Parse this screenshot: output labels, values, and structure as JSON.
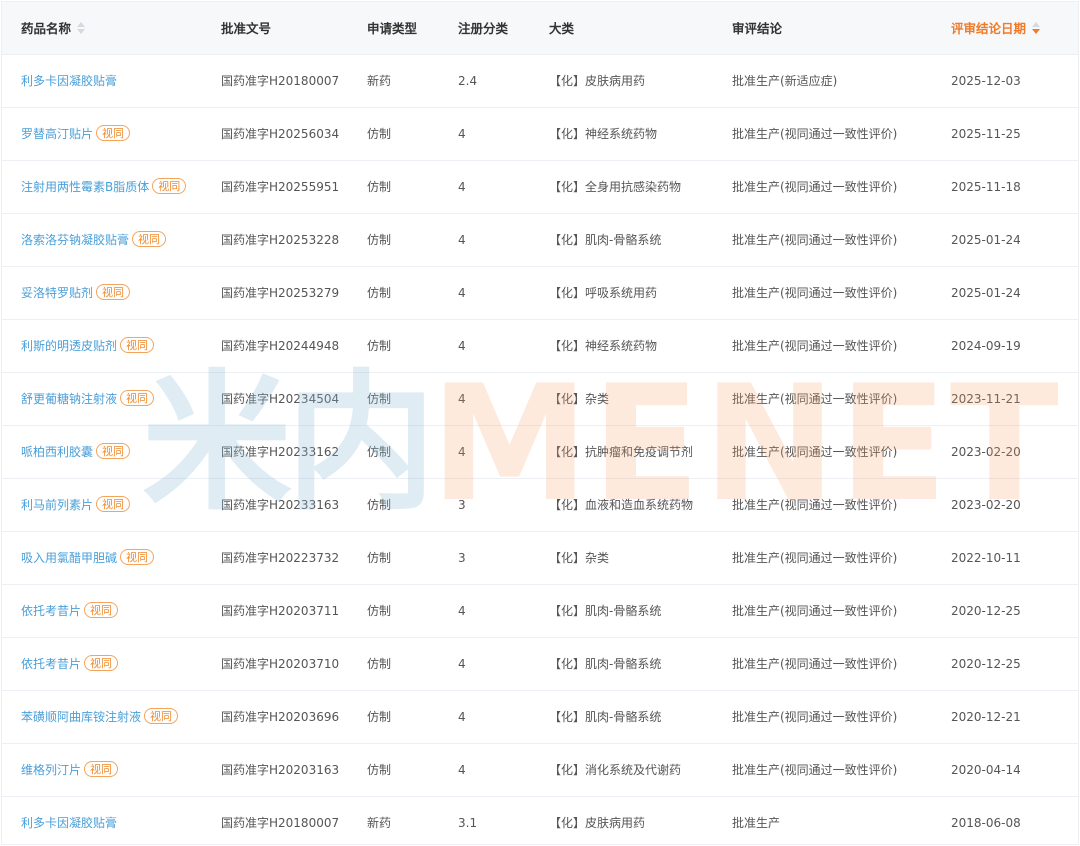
{
  "columns": {
    "name": "药品名称",
    "approval": "批准文号",
    "app_type": "申请类型",
    "reg_class": "注册分类",
    "category": "大类",
    "conclusion": "审评结论",
    "date": "评审结论日期"
  },
  "sort": {
    "active_column": "date",
    "direction": "desc"
  },
  "colors": {
    "link": "#4a9fd8",
    "tag": "#f08a2c",
    "active_header": "#f07b2a"
  },
  "rows": [
    {
      "name": "利多卡因凝胶贴膏",
      "tag": "",
      "approval": "国药准字H20180007",
      "app_type": "新药",
      "reg_class": "2.4",
      "category": "【化】皮肤病用药",
      "conclusion": "批准生产(新适应症)",
      "date": "2025-12-03"
    },
    {
      "name": "罗替高汀贴片",
      "tag": "视同",
      "approval": "国药准字H20256034",
      "app_type": "仿制",
      "reg_class": "4",
      "category": "【化】神经系统药物",
      "conclusion": "批准生产(视同通过一致性评价)",
      "date": "2025-11-25"
    },
    {
      "name": "注射用两性霉素B脂质体",
      "tag": "视同",
      "approval": "国药准字H20255951",
      "app_type": "仿制",
      "reg_class": "4",
      "category": "【化】全身用抗感染药物",
      "conclusion": "批准生产(视同通过一致性评价)",
      "date": "2025-11-18"
    },
    {
      "name": "洛索洛芬钠凝胶贴膏",
      "tag": "视同",
      "approval": "国药准字H20253228",
      "app_type": "仿制",
      "reg_class": "4",
      "category": "【化】肌肉-骨骼系统",
      "conclusion": "批准生产(视同通过一致性评价)",
      "date": "2025-01-24"
    },
    {
      "name": "妥洛特罗贴剂",
      "tag": "视同",
      "approval": "国药准字H20253279",
      "app_type": "仿制",
      "reg_class": "4",
      "category": "【化】呼吸系统用药",
      "conclusion": "批准生产(视同通过一致性评价)",
      "date": "2025-01-24"
    },
    {
      "name": "利斯的明透皮贴剂",
      "tag": "视同",
      "approval": "国药准字H20244948",
      "app_type": "仿制",
      "reg_class": "4",
      "category": "【化】神经系统药物",
      "conclusion": "批准生产(视同通过一致性评价)",
      "date": "2024-09-19"
    },
    {
      "name": "舒更葡糖钠注射液",
      "tag": "视同",
      "approval": "国药准字H20234504",
      "app_type": "仿制",
      "reg_class": "4",
      "category": "【化】杂类",
      "conclusion": "批准生产(视同通过一致性评价)",
      "date": "2023-11-21"
    },
    {
      "name": "哌柏西利胶囊",
      "tag": "视同",
      "approval": "国药准字H20233162",
      "app_type": "仿制",
      "reg_class": "4",
      "category": "【化】抗肿瘤和免疫调节剂",
      "conclusion": "批准生产(视同通过一致性评价)",
      "date": "2023-02-20"
    },
    {
      "name": "利马前列素片",
      "tag": "视同",
      "approval": "国药准字H20233163",
      "app_type": "仿制",
      "reg_class": "3",
      "category": "【化】血液和造血系统药物",
      "conclusion": "批准生产(视同通过一致性评价)",
      "date": "2023-02-20"
    },
    {
      "name": "吸入用氯醋甲胆碱",
      "tag": "视同",
      "approval": "国药准字H20223732",
      "app_type": "仿制",
      "reg_class": "3",
      "category": "【化】杂类",
      "conclusion": "批准生产(视同通过一致性评价)",
      "date": "2022-10-11"
    },
    {
      "name": "依托考昔片",
      "tag": "视同",
      "approval": "国药准字H20203711",
      "app_type": "仿制",
      "reg_class": "4",
      "category": "【化】肌肉-骨骼系统",
      "conclusion": "批准生产(视同通过一致性评价)",
      "date": "2020-12-25"
    },
    {
      "name": "依托考昔片",
      "tag": "视同",
      "approval": "国药准字H20203710",
      "app_type": "仿制",
      "reg_class": "4",
      "category": "【化】肌肉-骨骼系统",
      "conclusion": "批准生产(视同通过一致性评价)",
      "date": "2020-12-25"
    },
    {
      "name": "苯磺顺阿曲库铵注射液",
      "tag": "视同",
      "approval": "国药准字H20203696",
      "app_type": "仿制",
      "reg_class": "4",
      "category": "【化】肌肉-骨骼系统",
      "conclusion": "批准生产(视同通过一致性评价)",
      "date": "2020-12-21"
    },
    {
      "name": "维格列汀片",
      "tag": "视同",
      "approval": "国药准字H20203163",
      "app_type": "仿制",
      "reg_class": "4",
      "category": "【化】消化系统及代谢药",
      "conclusion": "批准生产(视同通过一致性评价)",
      "date": "2020-04-14"
    },
    {
      "name": "利多卡因凝胶贴膏",
      "tag": "",
      "approval": "国药准字H20180007",
      "app_type": "新药",
      "reg_class": "3.1",
      "category": "【化】皮肤病用药",
      "conclusion": "批准生产",
      "date": "2018-06-08"
    }
  ],
  "watermark": {
    "cn": "米内",
    "en": "MENET"
  }
}
